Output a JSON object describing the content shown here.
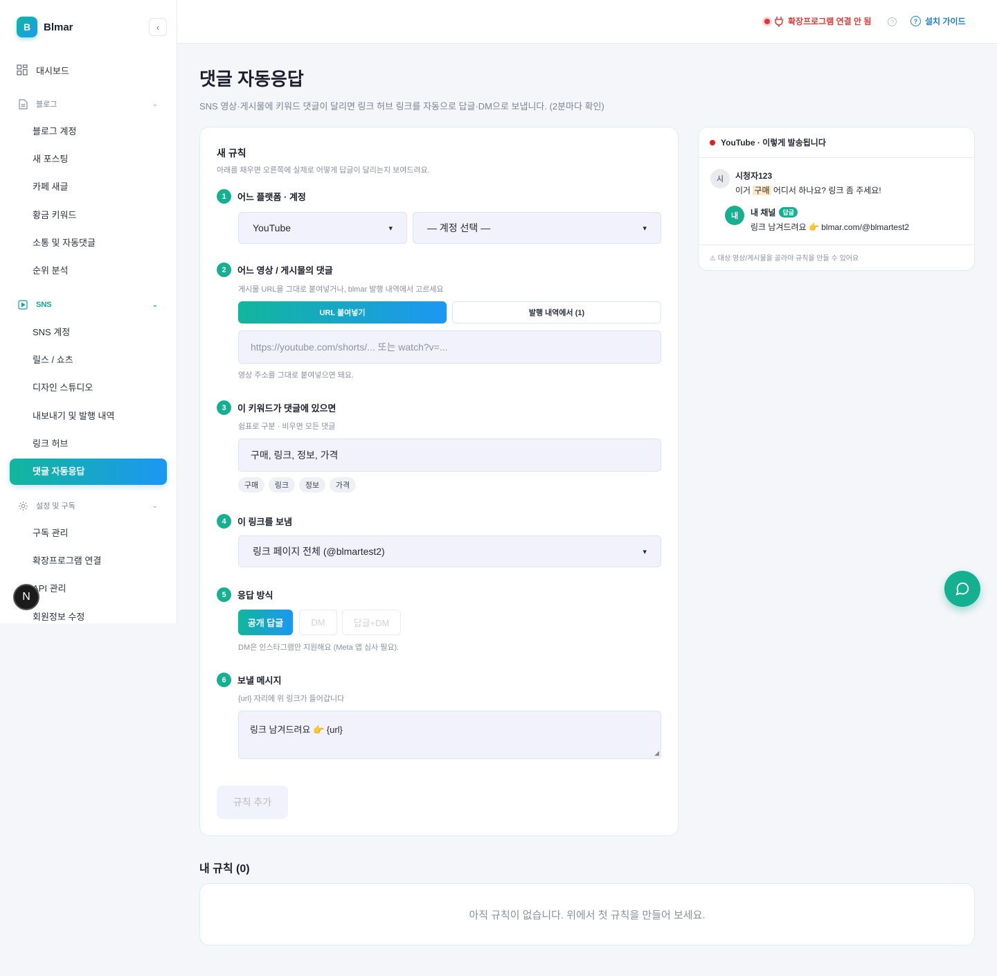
{
  "app": {
    "logo_letter": "B",
    "name": "Blmar"
  },
  "sidebar": {
    "dashboard": "대시보드",
    "blog_group": "블로그",
    "blog_items": [
      "블로그 계정",
      "새 포스팅",
      "카페 새글",
      "황금 키워드",
      "소통 및 자동댓글",
      "순위 분석"
    ],
    "sns_group": "SNS",
    "sns_items": [
      "SNS 계정",
      "릴스 / 쇼츠",
      "디자인 스튜디오",
      "내보내기 및 발행 내역",
      "링크 허브",
      "댓글 자동응답"
    ],
    "settings_group": "설정 및 구독",
    "settings_items": [
      "구독 관리",
      "확장프로그램 연결",
      "API 관리",
      "회원정보 수정"
    ],
    "user_badge": "N"
  },
  "topbar": {
    "extension_status": "확장프로그램 연결 안 됨",
    "help": "?",
    "guide": "설치 가이드"
  },
  "page": {
    "title": "댓글 자동응답",
    "subtitle": "SNS 영상·게시물에 키워드 댓글이 달리면 링크 허브 링크를 자동으로 답글·DM으로 보냅니다. (2분마다 확인)"
  },
  "form": {
    "title": "새 규칙",
    "subtitle": "아래를 채우면 오른쪽에 실제로 어떻게 답글이 달리는지 보여드려요.",
    "step1": {
      "num": "1",
      "label": "어느 플랫폼 · 계정",
      "platform": "YouTube",
      "account": "— 계정 선택 —"
    },
    "step2": {
      "num": "2",
      "label": "어느 영상 / 게시물의 댓글",
      "hint": "게시물 URL을 그대로 붙여넣거나, blmar 발행 내역에서 고르세요",
      "tab_url": "URL 붙여넣기",
      "tab_history": "발행 내역에서 (1)",
      "url_placeholder": "https://youtube.com/shorts/... 또는 watch?v=...",
      "url_hint": "영상 주소를 그대로 붙여넣으면 돼요."
    },
    "step3": {
      "num": "3",
      "label": "이 키워드가 댓글에 있으면",
      "hint": "쉼표로 구분 · 비우면 모든 댓글",
      "value": "구매, 링크, 정보, 가격",
      "chips": [
        "구매",
        "링크",
        "정보",
        "가격"
      ]
    },
    "step4": {
      "num": "4",
      "label": "이 링크를 보냄",
      "value": "링크 페이지 전체 (@blmartest2)"
    },
    "step5": {
      "num": "5",
      "label": "응답 방식",
      "modes": [
        "공개 답글",
        "DM",
        "답글+DM"
      ],
      "hint": "DM은 인스타그램만 지원해요 (Meta 앱 심사 필요)."
    },
    "step6": {
      "num": "6",
      "label": "보낼 메시지",
      "hint": "{url} 자리에 위 링크가 들어갑니다",
      "value": "링크 남겨드려요 👉 {url}"
    },
    "submit": "규칙 추가"
  },
  "preview": {
    "header": "YouTube · 이렇게 발송됩니다",
    "commenter_avatar": "시",
    "commenter_name": "시청자123",
    "comment_before": "이거 ",
    "comment_keyword": "구매",
    "comment_after": " 어디서 하나요? 링크 좀 주세요!",
    "reply_avatar": "내",
    "reply_name": "내 채널",
    "reply_badge": "답글",
    "reply_text": "링크 남겨드려요 👉 blmar.com/@blmartest2",
    "footer": "⚠ 대상 영상/게시물을 골라야 규칙을 만들 수 있어요"
  },
  "rules": {
    "title": "내 규칙 (0)",
    "empty": "아직 규칙이 없습니다. 위에서 첫 규칙을 만들어 보세요."
  },
  "colors": {
    "accent": "#14b08f",
    "accent_blue": "#1c97f4",
    "error": "#e03a3a",
    "link": "#1a7fe0"
  }
}
